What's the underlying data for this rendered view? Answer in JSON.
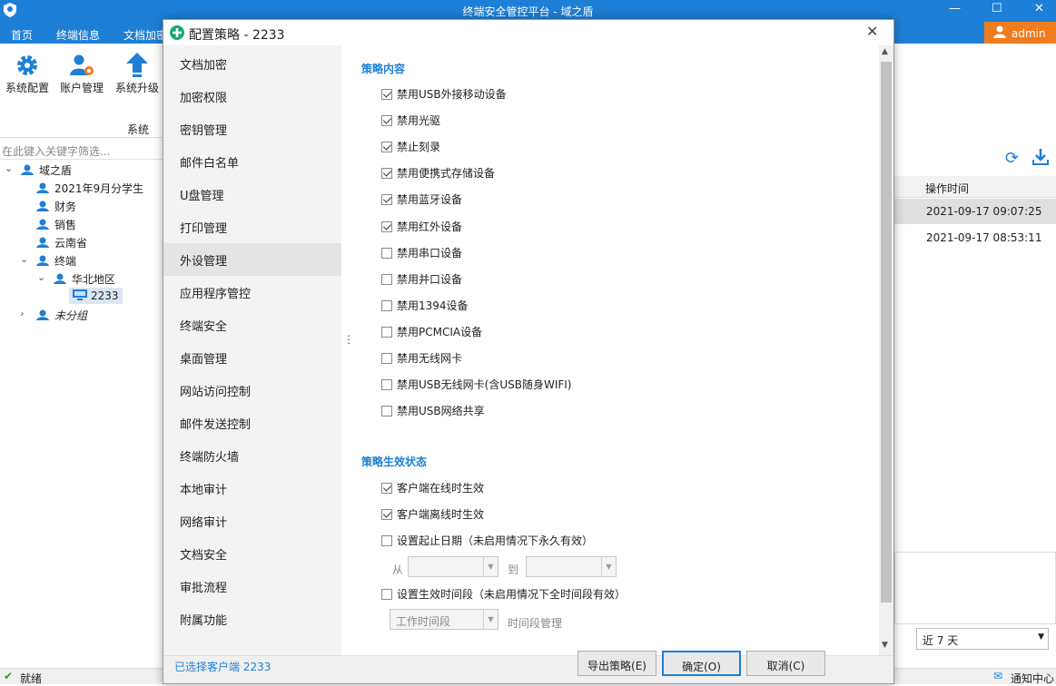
{
  "app": {
    "title": "终端安全管控平台 - 域之盾"
  },
  "menubar": {
    "items": [
      "首页",
      "终端信息",
      "文档加密"
    ],
    "user": "admin"
  },
  "ribbon": {
    "buttons": [
      "系统配置",
      "账户管理",
      "系统升级"
    ],
    "group_label": "系统"
  },
  "filter": {
    "placeholder": "在此键入关键字筛选..."
  },
  "tree": {
    "root": "域之盾",
    "groups": [
      "2021年9月分学生",
      "财务",
      "销售",
      "云南省"
    ],
    "terminal_group": "终端",
    "region": "华北地区",
    "client": "2233",
    "ungrouped": "未分组"
  },
  "right_panel": {
    "column_header": "操作时间",
    "rows": [
      "2021-09-17 09:07:25",
      "2021-09-17 08:53:11"
    ],
    "range_select": "近 7 天",
    "notify_label": "通知中心"
  },
  "status": {
    "text": "就绪"
  },
  "dialog": {
    "title": "配置策略 - 2233",
    "nav": [
      "文档加密",
      "加密权限",
      "密钥管理",
      "邮件白名单",
      "U盘管理",
      "打印管理",
      "外设管理",
      "应用程序管控",
      "终端安全",
      "桌面管理",
      "网站访问控制",
      "邮件发送控制",
      "终端防火墙",
      "本地审计",
      "网络审计",
      "文档安全",
      "审批流程",
      "附属功能"
    ],
    "selected_nav_index": 6,
    "policy_section": "策略内容",
    "policy_items": [
      {
        "label": "禁用USB外接移动设备",
        "checked": true
      },
      {
        "label": "禁用光驱",
        "checked": true
      },
      {
        "label": "禁止刻录",
        "checked": true
      },
      {
        "label": "禁用便携式存储设备",
        "checked": true
      },
      {
        "label": "禁用蓝牙设备",
        "checked": true
      },
      {
        "label": "禁用红外设备",
        "checked": true
      },
      {
        "label": "禁用串口设备",
        "checked": false
      },
      {
        "label": "禁用并口设备",
        "checked": false
      },
      {
        "label": "禁用1394设备",
        "checked": false
      },
      {
        "label": "禁用PCMCIA设备",
        "checked": false
      },
      {
        "label": "禁用无线网卡",
        "checked": false
      },
      {
        "label": "禁用USB无线网卡(含USB随身WIFI)",
        "checked": false
      },
      {
        "label": "禁用USB网络共享",
        "checked": false
      }
    ],
    "effect_section": "策略生效状态",
    "effect_items": [
      {
        "label": "客户端在线时生效",
        "checked": true
      },
      {
        "label": "客户端离线时生效",
        "checked": true
      },
      {
        "label": "设置起止日期（未启用情况下永久有效）",
        "checked": false
      }
    ],
    "from_label": "从",
    "to_label": "到",
    "period_item": {
      "label": "设置生效时间段（未启用情况下全时间段有效）",
      "checked": false
    },
    "period_combo": "工作时间段",
    "period_manage": "时间段管理",
    "selected_client": "已选择客户端 2233",
    "buttons": {
      "export": "导出策略(E)",
      "ok": "确定(O)",
      "cancel": "取消(C)"
    }
  },
  "colors": {
    "brand_blue": "#1e7fd6",
    "admin_orange": "#f07c1e",
    "section_blue": "#1e7fd6"
  }
}
